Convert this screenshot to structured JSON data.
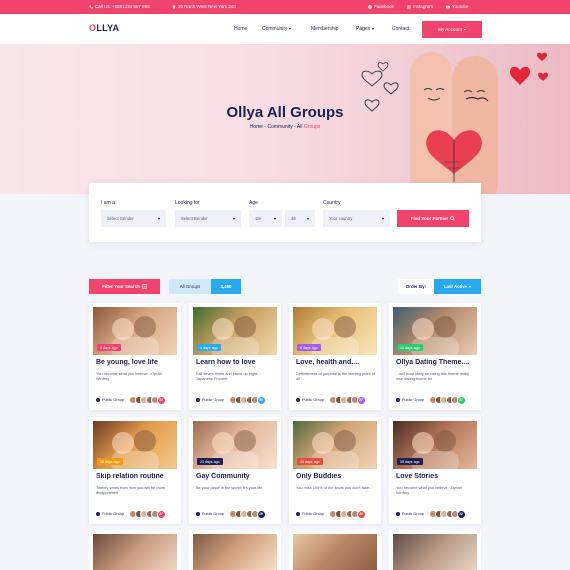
{
  "topbar": {
    "call": "Call Us: +0881234 567 890",
    "address": "30 North West New York 240",
    "social": [
      "Facebook",
      "Instagram",
      "Youtube"
    ]
  },
  "nav": {
    "logo_accent": "O",
    "logo_rest": "LLYA",
    "items": [
      {
        "label": "Home"
      },
      {
        "label": "Community"
      },
      {
        "label": "Membership"
      },
      {
        "label": "Pages"
      },
      {
        "label": "Contact"
      }
    ],
    "account": "My Account"
  },
  "hero": {
    "title": "Ollya All Groups",
    "breadcrumb_prefix": "Home - Community - All ",
    "breadcrumb_current": "Groups"
  },
  "search": {
    "iam_label": "I am a",
    "iam_value": "Select Gender",
    "looking_label": "Looking for",
    "looking_value": "Select Gender",
    "age_label": "Age",
    "age_from": "18+",
    "age_to": "48",
    "country_label": "Country",
    "country_value": "Your country",
    "button": "Find Your Partner"
  },
  "filters": {
    "filter_button": "Filter Your Search",
    "all_groups_label": "All Groups",
    "all_groups_count": "3,450",
    "order_label": "Order By:",
    "order_value": "Last Active"
  },
  "cards": [
    {
      "badge": "2 days ago",
      "title": "Be young, love life",
      "desc": "You become what you believe. -Oprah Winfrey",
      "type": "Public Group",
      "count": "32",
      "badge_color": "#f2436f",
      "count_color": "#f2436f"
    },
    {
      "badge": "4 days ago",
      "title": "Learn how to love",
      "desc": "Fall seven times and stand up eight. -Japanese Proverb",
      "type": "Public Group",
      "count": "59",
      "badge_color": "#29a9f0",
      "count_color": "#29a9f0"
    },
    {
      "badge": "8 days ago",
      "title": "Love, health and....",
      "desc": "Definiteness of purpose is the starting point of all",
      "type": "Public Group",
      "count": "27",
      "badge_color": "#a55eea",
      "count_color": "#a55eea"
    },
    {
      "badge": "12 days ago",
      "title": "Ollya Dating Theme....",
      "desc": "...will most likely be using this theme really nice dating theme for",
      "type": "Public Group",
      "count": "17",
      "badge_color": "#2ecc71",
      "count_color": "#2ecc71"
    },
    {
      "badge": "16 days ago",
      "title": "Skip relation routine",
      "desc": "Twenty years from now you will be more disappointed",
      "type": "Public Group",
      "count": "27",
      "badge_color": "#f39c12",
      "count_color": "#f2436f"
    },
    {
      "badge": "21 days ago",
      "title": "Gay Community",
      "desc": "Be your place in the world; it's your life.",
      "type": "Public Group",
      "count": "29",
      "badge_color": "#1e2150",
      "count_color": "#1e2150"
    },
    {
      "badge": "24 days ago",
      "title": "Only Buddies",
      "desc": "You miss 100% of the shots you don't take.",
      "type": "Public Group",
      "count": "29",
      "badge_color": "#e74c3c",
      "count_color": "#e74c3c"
    },
    {
      "badge": "30 days ago",
      "title": "Love Stories",
      "desc": "You become what you believe. -Oprah Winfrey",
      "type": "Public Group",
      "count": "22",
      "badge_color": "#1e2150",
      "count_color": "#1e2150"
    }
  ],
  "colors": {
    "accent": "#f2436f",
    "blue": "#29a9f0",
    "navy": "#1e2150"
  }
}
